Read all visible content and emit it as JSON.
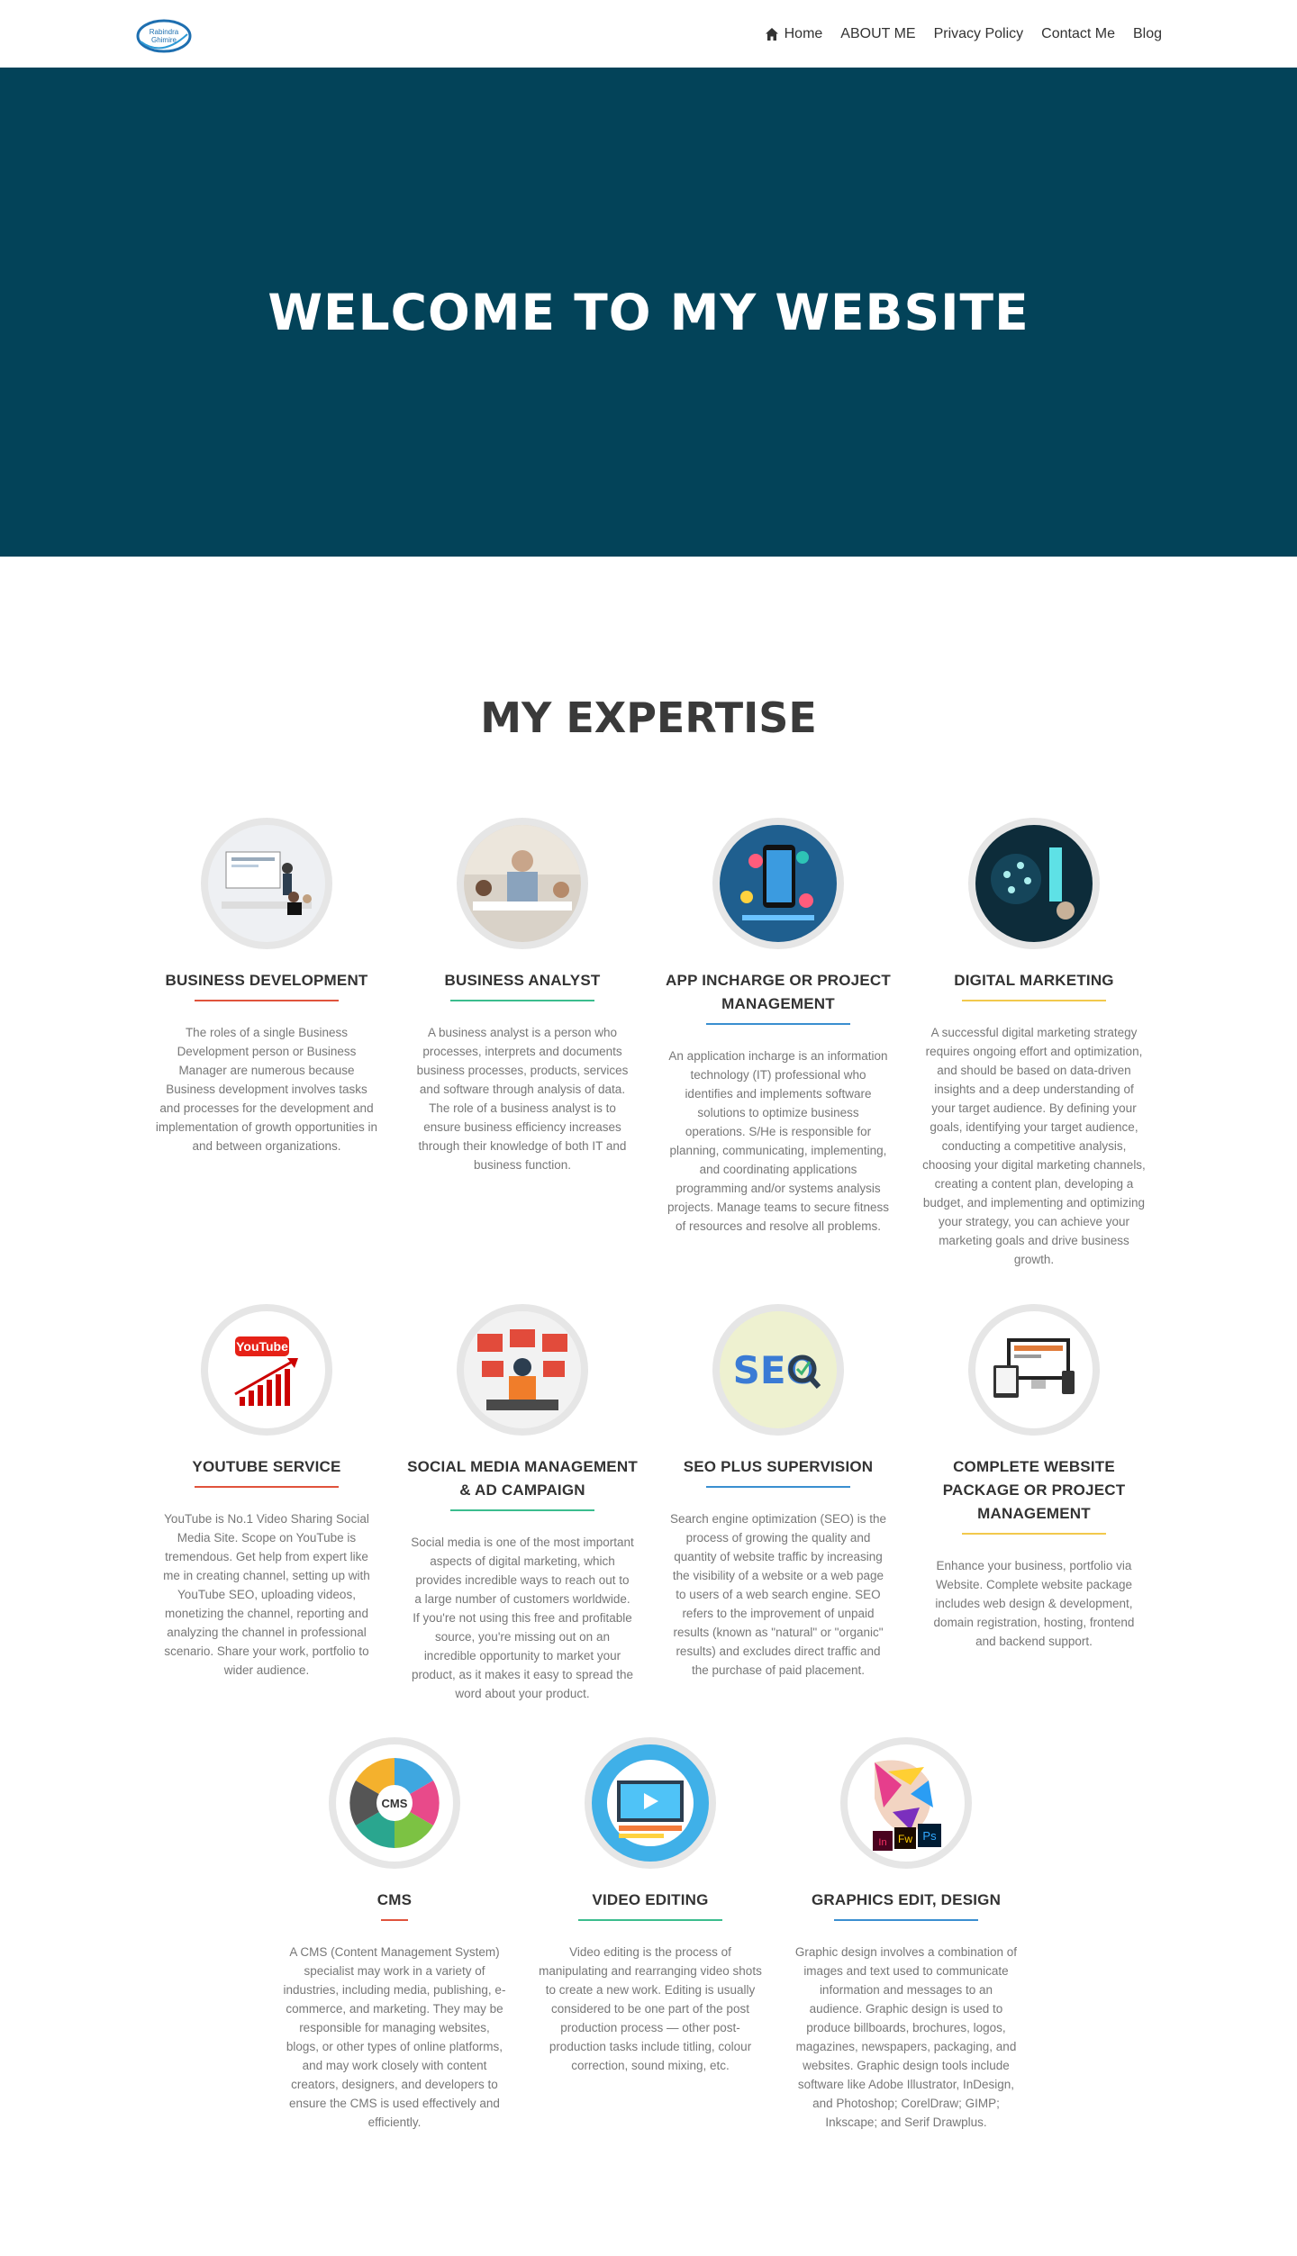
{
  "logo": {
    "line1": "Rabindra",
    "line2": "Ghimire"
  },
  "nav": {
    "home": "Home",
    "about": "ABOUT ME",
    "privacy": "Privacy Policy",
    "contact": "Contact Me",
    "blog": "Blog"
  },
  "hero": {
    "title": "WELCOME TO MY WEBSITE"
  },
  "expertise": {
    "title": "MY EXPERTISE",
    "cards": [
      {
        "title": "BUSINESS DEVELOPMENT",
        "text": "The roles of a single Business Development person or Business Manager are numerous because Business development involves tasks and processes for the development and implementation of growth opportunities in and between organizations."
      },
      {
        "title": "BUSINESS ANALYST",
        "text": "A business analyst is a person who processes, interprets and documents business processes, products, services and software through analysis of data. The role of a business analyst is to ensure business efficiency increases through their knowledge of both IT and business function."
      },
      {
        "title": "APP INCHARGE OR PROJECT MANAGEMENT",
        "text": "An application incharge is an information technology (IT) professional who identifies and implements software solutions to optimize business operations. S/He is responsible for planning, communicating, implementing, and coordinating applications programming and/or systems analysis projects. Manage teams to secure fitness of resources and resolve all problems."
      },
      {
        "title": "DIGITAL MARKETING",
        "text": "A successful digital marketing strategy requires ongoing effort and optimization, and should be based on data-driven insights and a deep understanding of your target audience. By defining your goals, identifying your target audience, conducting a competitive analysis, choosing your digital marketing channels, creating a content plan, developing a budget, and implementing and optimizing your strategy, you can achieve your marketing goals and drive business growth."
      },
      {
        "title": "YOUTUBE SERVICE",
        "text": "YouTube is No.1 Video Sharing Social Media Site. Scope on YouTube is tremendous. Get help from expert like me in creating channel, setting up with YouTube SEO, uploading videos, monetizing the channel, reporting and analyzing the channel in professional scenario. Share your work, portfolio to wider audience."
      },
      {
        "title": "SOCIAL MEDIA MANAGEMENT & AD CAMPAIGN",
        "text": "Social media is one of the most important aspects of digital marketing, which provides incredible ways to reach out to a large number of customers worldwide. If you're not using this free and profitable source, you're missing out on an incredible opportunity to market your product, as it makes it easy to spread the word about your product."
      },
      {
        "title": "SEO PLUS SUPERVISION",
        "text": "Search engine optimization (SEO) is the process of growing the quality and quantity of website traffic by increasing the visibility of a website or a web page to users of a web search engine. SEO refers to the improvement of unpaid results (known as \"natural\" or \"organic\" results) and excludes direct traffic and the purchase of paid placement."
      },
      {
        "title": "COMPLETE WEBSITE PACKAGE OR PROJECT MANAGEMENT",
        "text": "Enhance your business, portfolio via Website. Complete website package includes web design & development, domain registration, hosting, frontend and backend support."
      },
      {
        "title": "CMS",
        "text": "A CMS (Content Management System) specialist may work in a variety of industries, including media, publishing, e-commerce, and marketing. They may be responsible for managing websites, blogs, or other types of online platforms, and may work closely with content creators, designers, and developers to ensure the CMS is used effectively and efficiently."
      },
      {
        "title": "VIDEO EDITING",
        "text": "Video editing is the process of manipulating and rearranging video shots to create a new work. Editing is usually considered to be one part of the post production process — other post-production tasks include titling, colour correction, sound mixing, etc."
      },
      {
        "title": "GRAPHICS EDIT, DESIGN",
        "text": "Graphic design involves a combination of images and text used to communicate information and messages to an audience. Graphic design is used to produce billboards, brochures, logos, magazines, newspapers, packaging, and websites. Graphic design tools include software like Adobe Illustrator, InDesign, and Photoshop; CorelDraw; GIMP; Inkscape; and Serif Drawplus."
      }
    ],
    "images": {
      "cms": "CMS",
      "seo": "SEO",
      "youtube": "YouTube",
      "graphics_in": "In",
      "graphics_fw": "Fw",
      "graphics_ps": "Ps"
    }
  },
  "colors": {
    "hero_bg": "#034359",
    "underline_red": "#e0533c",
    "underline_green": "#3bbd8e",
    "underline_blue": "#3a8fd0",
    "underline_yellow": "#f2c94c"
  }
}
